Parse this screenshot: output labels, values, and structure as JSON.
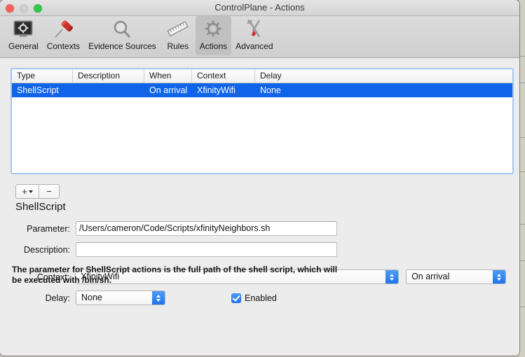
{
  "window": {
    "title": "ControlPlane - Actions",
    "traffic_lights": [
      {
        "name": "close-button",
        "color": "#fc605c"
      },
      {
        "name": "minimize-button",
        "color": "#cdcdcd"
      },
      {
        "name": "zoom-button",
        "color": "#34c749"
      }
    ]
  },
  "toolbar": {
    "items": [
      {
        "label": "General",
        "icon": "general-monitor-gear-icon",
        "selected": false
      },
      {
        "label": "Contexts",
        "icon": "pushpin-icon",
        "selected": false
      },
      {
        "label": "Evidence Sources",
        "icon": "magnifier-icon",
        "selected": false
      },
      {
        "label": "Rules",
        "icon": "ruler-icon",
        "selected": false
      },
      {
        "label": "Actions",
        "icon": "gear-icon",
        "selected": true
      },
      {
        "label": "Advanced",
        "icon": "wrench-screwdriver-icon",
        "selected": false
      }
    ]
  },
  "table": {
    "columns": [
      "Type",
      "Description",
      "When",
      "Context",
      "Delay"
    ],
    "rows": [
      {
        "type": "ShellScript",
        "description": "",
        "when": "On arrival",
        "context": "XfinityWifi",
        "delay": "None",
        "selected": true
      }
    ]
  },
  "list_controls": {
    "add_label": "+",
    "remove_label": "−"
  },
  "detail": {
    "heading": "ShellScript",
    "parameter": {
      "label": "Parameter:",
      "value": "/Users/cameron/Code/Scripts/xfinityNeighbors.sh",
      "placeholder": ""
    },
    "description": {
      "label": "Description:",
      "value": "",
      "placeholder": ""
    },
    "context": {
      "label": "Context:",
      "value": "XfinityWifi"
    },
    "when": {
      "value": "On arrival"
    },
    "delay": {
      "label": "Delay:",
      "value": "None"
    },
    "enabled": {
      "label": "Enabled",
      "checked": true
    },
    "help_text": "The parameter for ShellScript actions is the full path of the shell script, which will be executed with /bin/sh."
  },
  "colors": {
    "selection_blue": "#1064e8",
    "control_blue": "#1c75f0",
    "focus_ring": "#a4c6ef"
  }
}
